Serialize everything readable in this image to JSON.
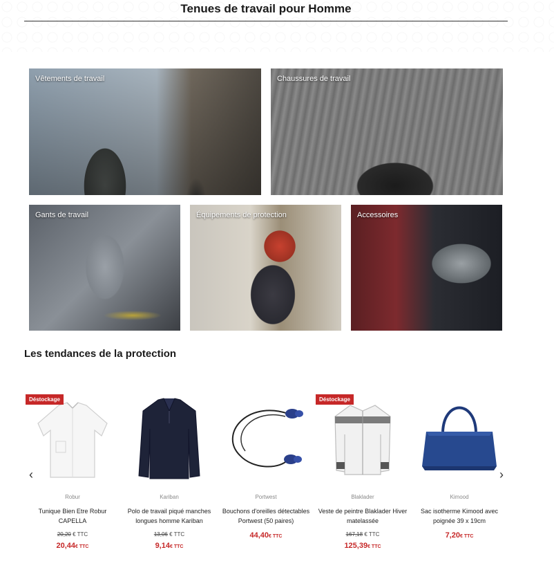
{
  "header": {
    "title": "Tenues de travail pour Homme"
  },
  "categories": [
    {
      "label": "Vêtements de travail"
    },
    {
      "label": "Chaussures de travail"
    },
    {
      "label": "Gants de travail"
    },
    {
      "label": "Équipements de protection"
    },
    {
      "label": "Accessoires"
    }
  ],
  "trending": {
    "title": "Les tendances de la protection",
    "prev_arrow": "‹",
    "next_arrow": "›",
    "products": [
      {
        "badge": "Déstockage",
        "brand": "Robur",
        "name": "Tunique Bien Etre Robur CAPELLA",
        "old_price": "20,20",
        "old_suffix": "€ TTC",
        "price": "20,44",
        "price_suffix": "€ TTC"
      },
      {
        "badge": "",
        "brand": "Kariban",
        "name": "Polo de travail piqué manches longues homme Kariban",
        "old_price": "13,06",
        "old_suffix": "€ TTC",
        "price": "9,14",
        "price_suffix": "€ TTC"
      },
      {
        "badge": "",
        "brand": "Portwest",
        "name": "Bouchons d'oreilles détectables Portwest (50 paires)",
        "old_price": "",
        "old_suffix": "",
        "price": "44,40",
        "price_suffix": "€ TTC"
      },
      {
        "badge": "Déstockage",
        "brand": "Blaklader",
        "name": "Veste de peintre Blaklader Hiver matelassée",
        "old_price": "167,18",
        "old_suffix": "€ TTC",
        "price": "125,39",
        "price_suffix": "€ TTC"
      },
      {
        "badge": "",
        "brand": "Kimood",
        "name": "Sac isotherme Kimood avec poignée 39 x 19cm",
        "old_price": "",
        "old_suffix": "",
        "price": "7,20",
        "price_suffix": "€ TTC"
      }
    ]
  },
  "colors": {
    "accent": "#c62828",
    "text": "#222222"
  }
}
